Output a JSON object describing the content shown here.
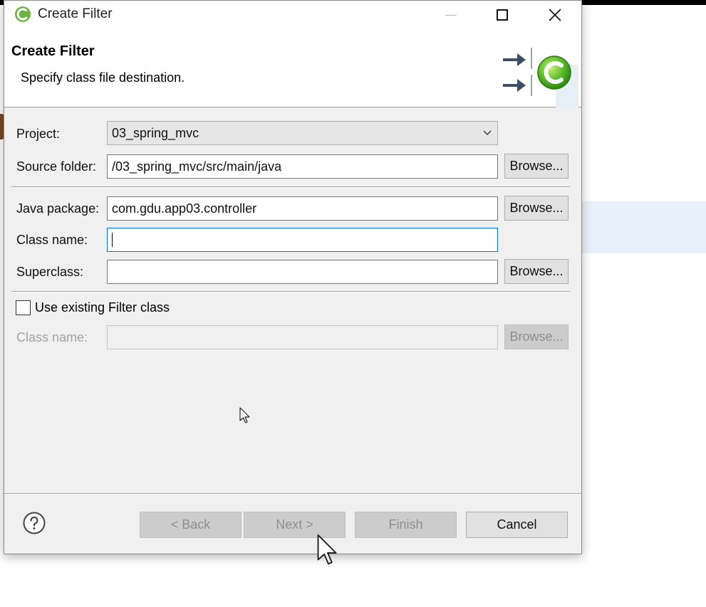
{
  "dialog": {
    "title": "Create Filter",
    "window_controls": [
      "minimize-icon",
      "maximize-icon",
      "close-icon"
    ]
  },
  "banner": {
    "title": "Create Filter",
    "subtitle": "Specify class file destination.",
    "icon": "new-class-wizard-icon"
  },
  "form": {
    "project": {
      "label": "Project:",
      "value": "03_spring_mvc"
    },
    "source_folder": {
      "label": "Source folder:",
      "value": "/03_spring_mvc/src/main/java",
      "button": "Browse..."
    },
    "java_package": {
      "label": "Java package:",
      "value": "com.gdu.app03.controller",
      "button": "Browse..."
    },
    "class_name": {
      "label": "Class name:",
      "value": ""
    },
    "superclass": {
      "label": "Superclass:",
      "value": "",
      "button": "Browse..."
    },
    "use_existing": {
      "label": "Use existing Filter class",
      "checked": false
    },
    "existing_class_name": {
      "label": "Class name:",
      "value": "",
      "button": "Browse..."
    }
  },
  "footer": {
    "help_icon": "help-icon",
    "back": "< Back",
    "next": "Next >",
    "finish": "Finish",
    "cancel": "Cancel"
  },
  "colors": {
    "focus_border": "#0078d7",
    "spring_green": "#6db33f",
    "disabled_text": "#8e8e8e"
  }
}
